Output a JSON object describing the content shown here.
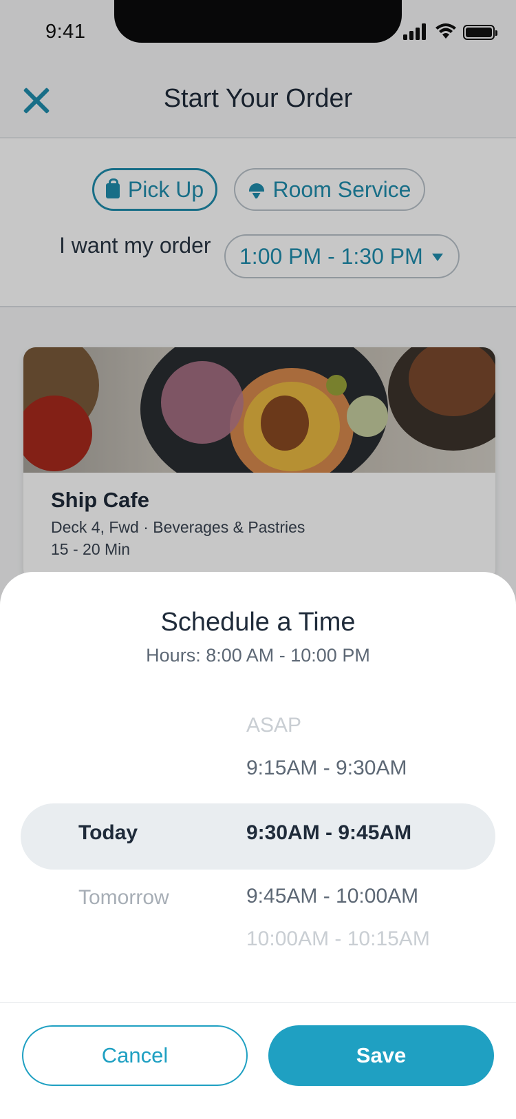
{
  "status_bar": {
    "time": "9:41"
  },
  "header": {
    "title": "Start Your Order"
  },
  "order_type": {
    "pickup_label": "Pick Up",
    "room_service_label": "Room Service",
    "want_label": "I want my order",
    "selected_window": "1:00 PM - 1:30 PM"
  },
  "restaurant": {
    "name": "Ship Cafe",
    "meta": "Deck 4, Fwd · Beverages & Pastries",
    "wait": "15 - 20 Min"
  },
  "schedule": {
    "title": "Schedule a Time",
    "hours": "Hours: 8:00 AM - 10:00 PM",
    "days": [
      "Today",
      "Tomorrow"
    ],
    "selected_day": "Today",
    "slots": [
      "ASAP",
      "9:15AM - 9:30AM",
      "9:30AM - 9:45AM",
      "9:45AM - 10:00AM",
      "10:00AM - 10:15AM"
    ],
    "selected_slot": "9:30AM - 9:45AM"
  },
  "actions": {
    "cancel_label": "Cancel",
    "save_label": "Save"
  },
  "colors": {
    "accent": "#1fa0c2",
    "text": "#1f2b3a",
    "highlight": "#e9edf0"
  }
}
